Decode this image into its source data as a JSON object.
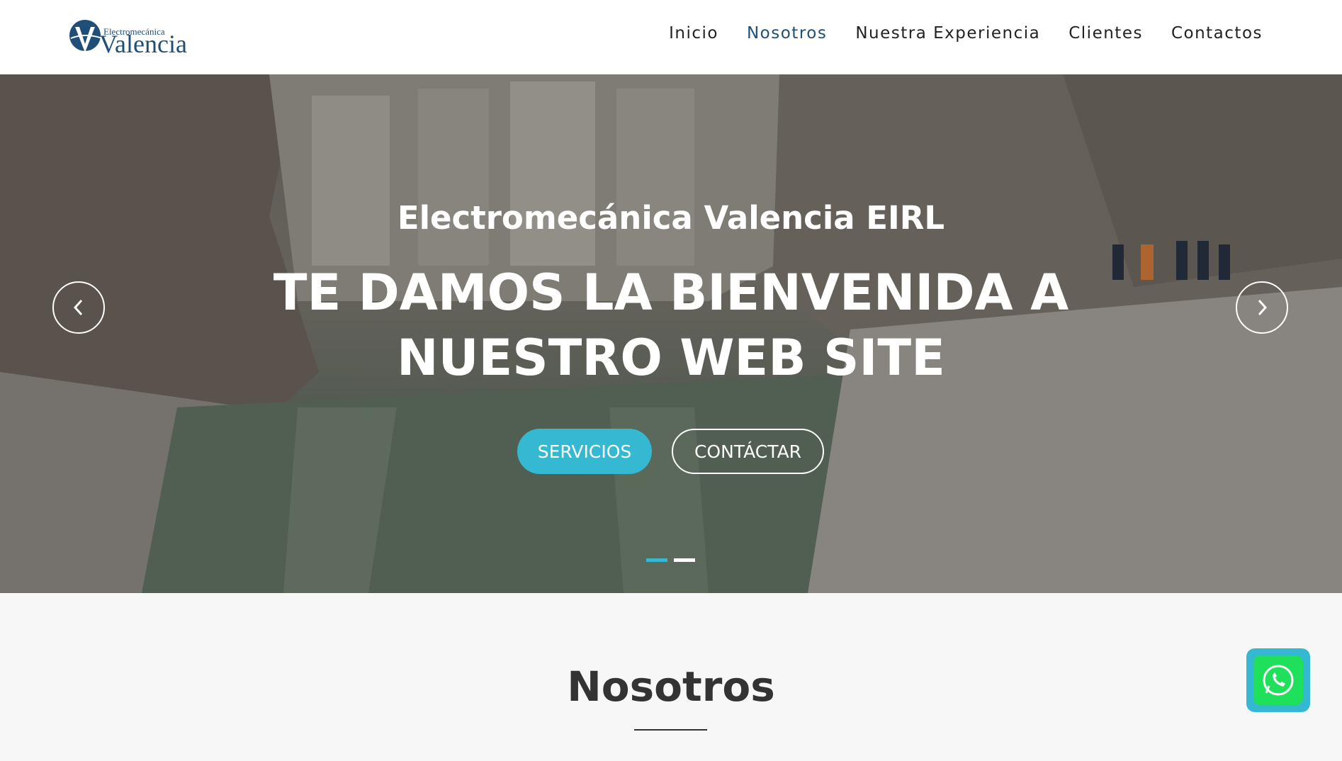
{
  "header": {
    "logo_small": "Electromecánica",
    "logo_big": "Valencia",
    "nav": [
      {
        "label": "Inicio"
      },
      {
        "label": "Nosotros"
      },
      {
        "label": "Nuestra Experiencia"
      },
      {
        "label": "Clientes"
      },
      {
        "label": "Contactos"
      }
    ],
    "active_nav": "Nosotros"
  },
  "hero": {
    "subtitle": "Electromecánica Valencia EIRL",
    "title": "TE DAMOS LA BIENVENIDA A NUESTRO WEB SITE",
    "primary_button": "SERVICIOS",
    "secondary_button": "CONTÁCTAR",
    "slide_count": 2,
    "active_slide": 1,
    "prev_icon": "chevron-left-icon",
    "next_icon": "chevron-right-icon"
  },
  "section": {
    "title": "Nosotros"
  },
  "floating": {
    "icon": "whatsapp-icon"
  },
  "colors": {
    "brand": "#1f4e79",
    "accent": "#35b8d1",
    "whatsapp": "#1fe05a"
  }
}
